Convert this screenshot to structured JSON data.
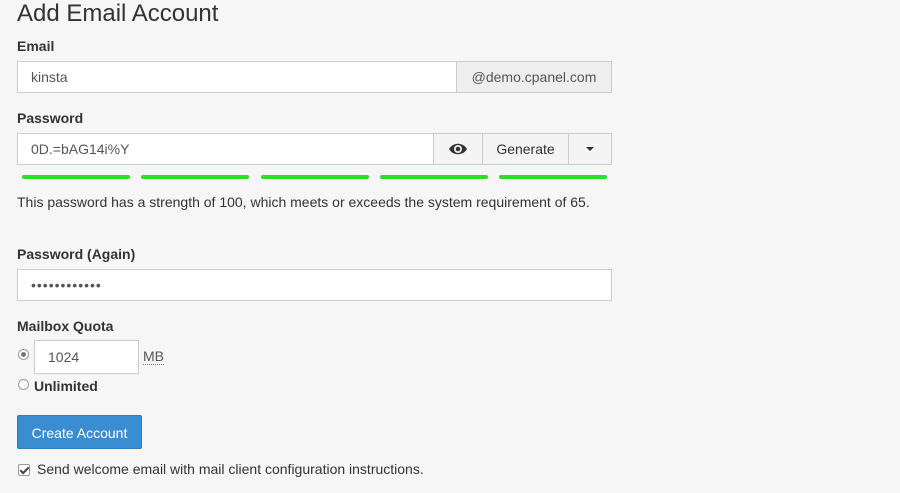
{
  "page": {
    "title": "Add Email Account"
  },
  "email": {
    "label": "Email",
    "value": "kinsta",
    "domain": "@demo.cpanel.com"
  },
  "password": {
    "label": "Password",
    "value": "0D.=bAG14i%Y",
    "generate_label": "Generate",
    "toggle_icon": "eye-icon",
    "dropdown_icon": "caret-down-icon",
    "strength_segments": 5,
    "strength_color": "#2edc2e",
    "strength_message": "This password has a strength of 100, which meets or exceeds the system requirement of 65."
  },
  "password_again": {
    "label": "Password (Again)",
    "masked_value": "••••••••••••"
  },
  "quota": {
    "label": "Mailbox Quota",
    "value": "1024",
    "unit": "MB",
    "unlimited_label": "Unlimited",
    "selected": "limited"
  },
  "actions": {
    "create_label": "Create Account",
    "welcome_email_label": "Send welcome email with mail client configuration instructions.",
    "welcome_email_checked": true
  },
  "colors": {
    "primary": "#3a8dd1",
    "background": "#f6f6f6"
  }
}
